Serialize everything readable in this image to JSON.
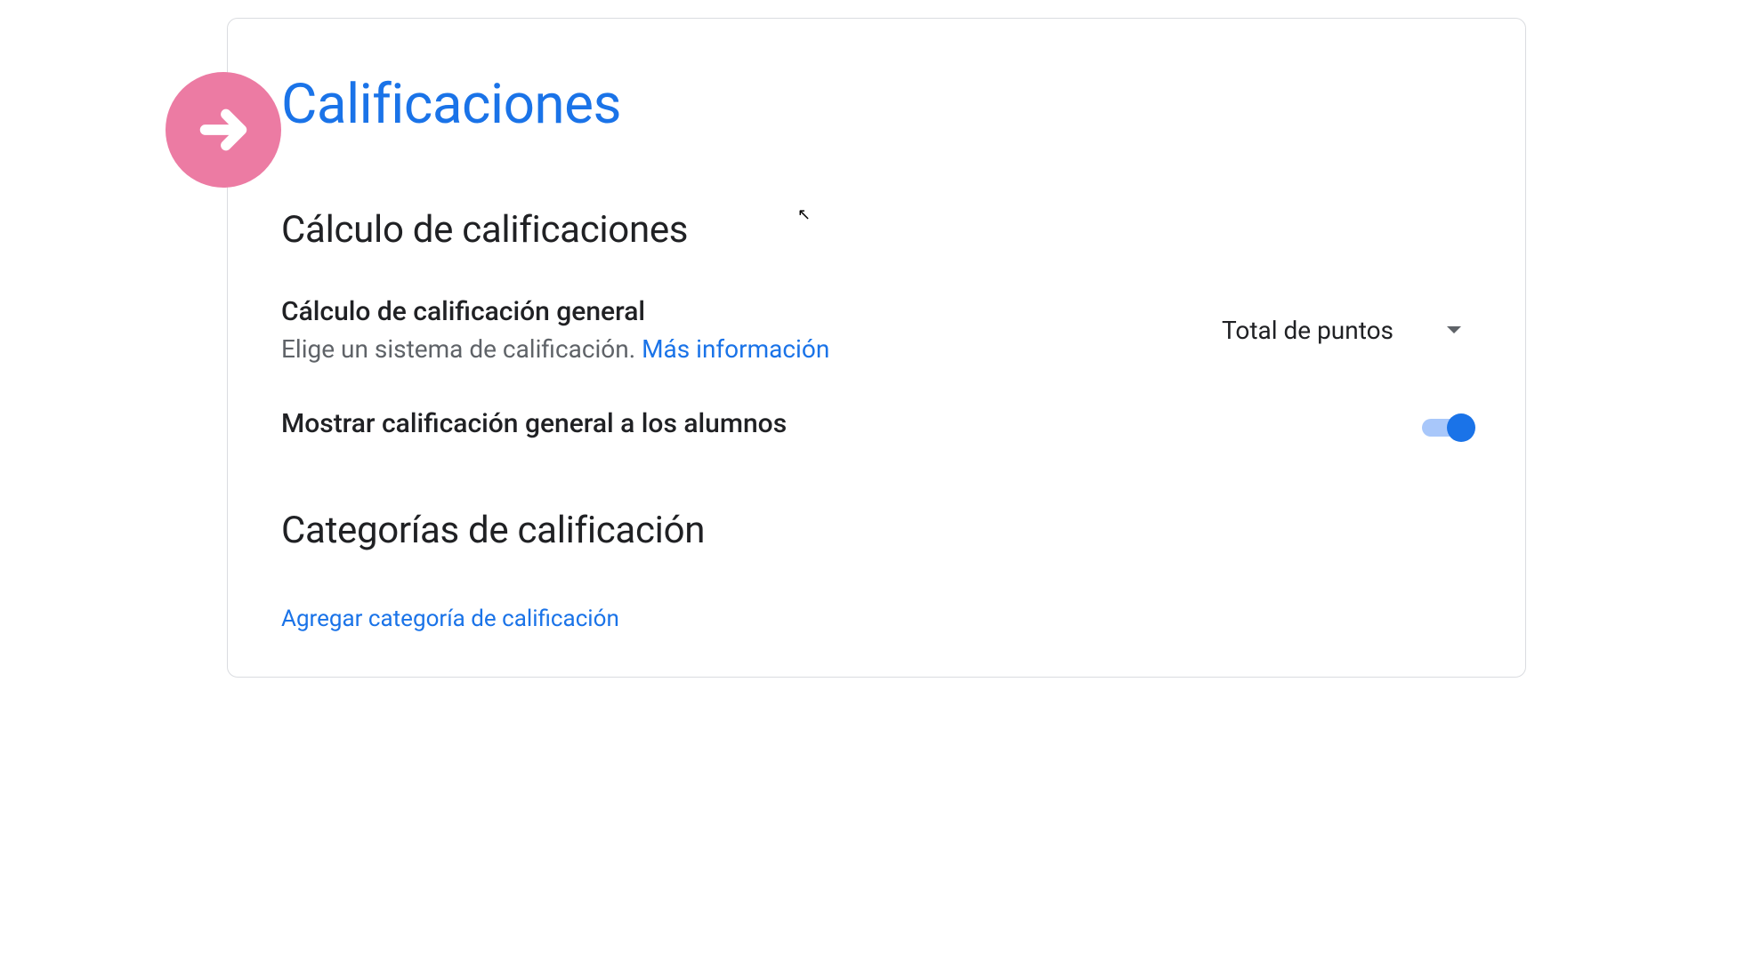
{
  "page": {
    "title": "Calificaciones"
  },
  "sections": {
    "calculation": {
      "heading": "Cálculo de calificaciones",
      "general_calc": {
        "label": "Cálculo de calificación general",
        "description": "Elige un sistema de calificación. ",
        "link_text": "Más información",
        "dropdown_value": "Total de puntos"
      },
      "show_to_students": {
        "label": "Mostrar calificación general a los alumnos",
        "toggle_on": true
      }
    },
    "categories": {
      "heading": "Categorías de calificación",
      "add_link": "Agregar categoría de calificación"
    }
  }
}
